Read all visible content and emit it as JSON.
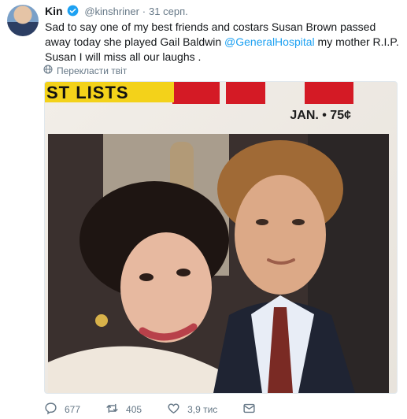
{
  "tweet": {
    "author_name": "Kin",
    "author_handle": "@kinshriner",
    "separator": "·",
    "date": "31 серп.",
    "text_before": "Sad to say one of my best friends and costars Susan Brown passed away today she played Gail Baldwin ",
    "mention": "@GeneralHospital",
    "text_after": " my mother R.I.P. Susan I will miss all our laughs ."
  },
  "translate_label": "Перекласти твіт",
  "media": {
    "banner_text": "ST LISTS",
    "issue_text": "JAN. • 75¢"
  },
  "actions": {
    "replies": "677",
    "retweets": "405",
    "likes": "3,9 тис"
  },
  "colors": {
    "link": "#1da1f2",
    "muted": "#657786",
    "magazine_red": "#d41a25",
    "magazine_yellow": "#f3d21a"
  },
  "icons": [
    "verified-badge-icon",
    "globe-icon",
    "reply-icon",
    "retweet-icon",
    "like-icon",
    "direct-message-icon"
  ]
}
